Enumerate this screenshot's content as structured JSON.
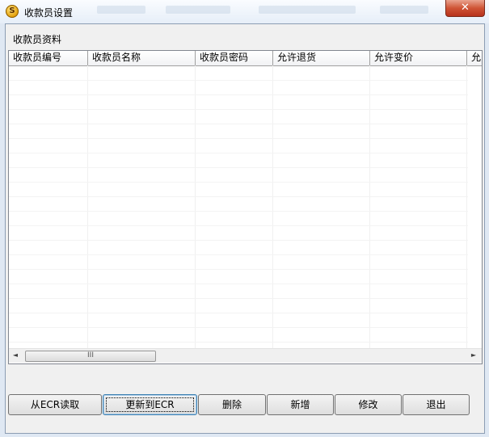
{
  "window": {
    "title": "收款员设置",
    "icon": "cashier-app-icon",
    "close_glyph": "✕"
  },
  "section_label": "收款员资料",
  "table": {
    "columns": [
      "收款员编号",
      "收款员名称",
      "收款员密码",
      "允许退货",
      "允许变价",
      "允"
    ],
    "rows": []
  },
  "scrollbar": {
    "left_arrow": "◄",
    "right_arrow": "►",
    "thumb_grip": "III"
  },
  "buttons": {
    "read_from_ecr": "从ECR读取",
    "update_to_ecr": "更新到ECR",
    "delete": "删除",
    "add": "新增",
    "edit": "修改",
    "exit": "退出"
  }
}
